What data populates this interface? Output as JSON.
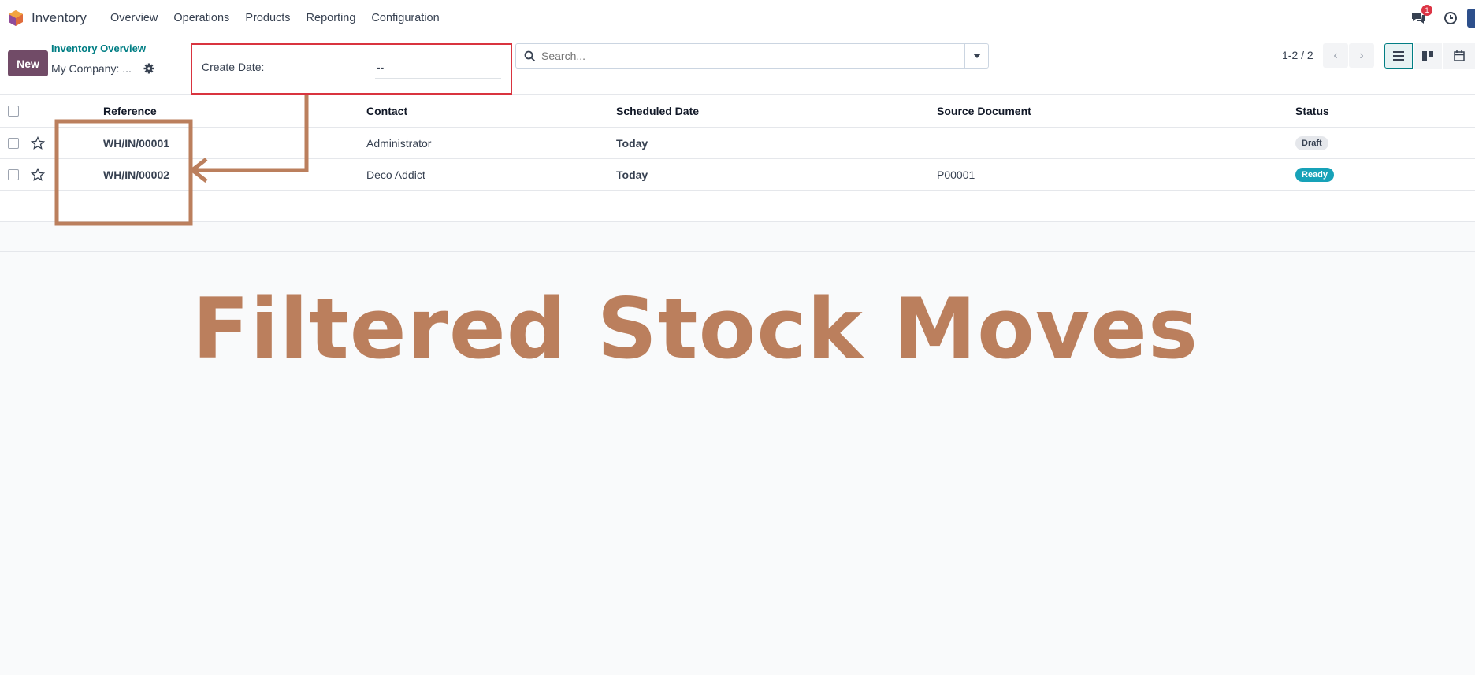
{
  "app": {
    "title": "Inventory",
    "menu": [
      "Overview",
      "Operations",
      "Products",
      "Reporting",
      "Configuration"
    ],
    "notifications_count": "1"
  },
  "control_panel": {
    "new_label": "New",
    "breadcrumb": "Inventory Overview",
    "company_filter": "My Company: ...",
    "create_date_label": "Create Date:",
    "create_date_value": "--",
    "search_placeholder": "Search...",
    "pager": "1-2 / 2"
  },
  "table": {
    "columns": [
      "Reference",
      "Contact",
      "Scheduled Date",
      "Source Document",
      "Status"
    ],
    "rows": [
      {
        "reference": "WH/IN/00001",
        "contact": "Administrator",
        "scheduled_date": "Today",
        "source_document": "",
        "status": "Draft"
      },
      {
        "reference": "WH/IN/00002",
        "contact": "Deco Addict",
        "scheduled_date": "Today",
        "source_document": "P00001",
        "status": "Ready"
      }
    ]
  },
  "overlay": {
    "title": "Filtered Stock Moves"
  },
  "colors": {
    "brand": "#714b67",
    "link": "#017e84",
    "highlight_box": "#d9343f",
    "annotation": "#bb7f5d",
    "today": "#936e1f",
    "ready": "#17a2b8"
  }
}
